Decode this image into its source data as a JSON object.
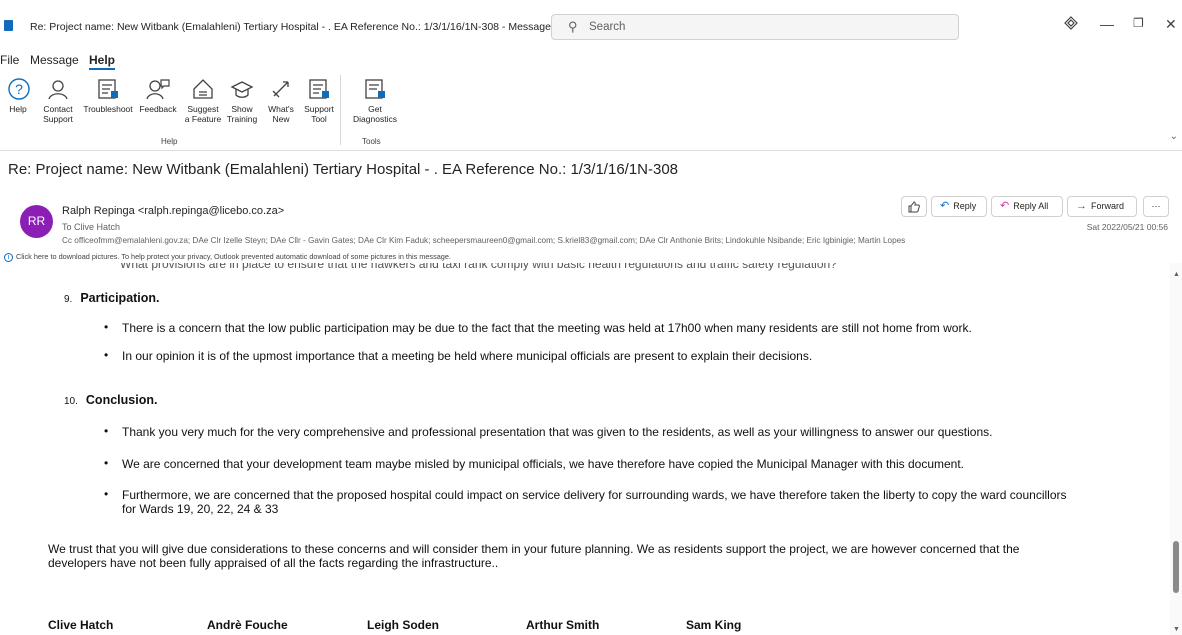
{
  "window": {
    "title": "Re: Project name: New Witbank (Emalahleni) Tertiary Hospital - . EA Reference No.: 1/3/1/16/1N-308  -  Message (HTML)",
    "search_placeholder": "Search"
  },
  "menu": {
    "file": "File",
    "message": "Message",
    "help": "Help"
  },
  "ribbon": {
    "help_group": {
      "label": "Help",
      "buttons": [
        {
          "line1": "Help",
          "line2": ""
        },
        {
          "line1": "Contact",
          "line2": "Support"
        },
        {
          "line1": "Troubleshoot",
          "line2": ""
        },
        {
          "line1": "Feedback",
          "line2": ""
        },
        {
          "line1": "Suggest",
          "line2": "a Feature"
        },
        {
          "line1": "Show",
          "line2": "Training"
        },
        {
          "line1": "What's",
          "line2": "New"
        },
        {
          "line1": "Support",
          "line2": "Tool"
        }
      ]
    },
    "tools_group": {
      "label": "Tools",
      "buttons": [
        {
          "line1": "Get",
          "line2": "Diagnostics"
        }
      ]
    }
  },
  "message": {
    "subject": "Re: Project name: New Witbank (Emalahleni) Tertiary Hospital - . EA Reference No.: 1/3/1/16/1N-308",
    "avatar_initials": "RR",
    "from": "Ralph Repinga <ralph.repinga@licebo.co.za>",
    "to": "To  Clive Hatch",
    "cc": "Cc  officeofmm@emalahleni.gov.za; DAe Clr Izelle Steyn; DAe Cllr - Gavin Gates; DAe Clr Kim Faduk; scheepersmaureen0@gmail.com; S.kriel83@gmail.com; DAe Clr Anthonie Brits; Lindokuhle Nsibande; Eric Igbinigie; Martin Lopes",
    "info_bar": "Click here to download pictures. To help protect your privacy, Outlook prevented automatic download of some pictures in this message.",
    "date": "Sat 2022/05/21 00:56",
    "actions": {
      "reply": "Reply",
      "reply_all": "Reply All",
      "forward": "Forward",
      "more": "···"
    }
  },
  "body": {
    "cut_line": "What provisions are in place to ensure that the hawkers and taxi rank comply with basic health regulations and traffic safety regulation?",
    "section9": {
      "number": "9.",
      "title": "Participation.",
      "bullets": [
        "There is a concern that the low public participation may be due to the fact that the meeting was held at 17h00 when many residents are still not home from work.",
        "In our opinion it is of the upmost importance that a meeting be held where municipal officials are present to explain their decisions."
      ]
    },
    "section10": {
      "number": "10.",
      "title": "Conclusion.",
      "bullets": [
        "Thank you very much for the very comprehensive and professional presentation that was given to the residents, as well as your willingness to answer our questions.",
        "We are concerned that your development team maybe misled by municipal officials, we have therefore have copied the Municipal Manager with this document.",
        "Furthermore, we are concerned that the proposed hospital could impact on service delivery for surrounding wards, we have therefore taken the liberty to copy the ward councillors",
        "for Wards 19, 20, 22, 24 & 33"
      ]
    },
    "closing": "We trust that you will give due considerations to these concerns and will consider them in your future planning. We as residents support the project, we are however concerned that the",
    "closing2": "developers have not been fully appraised of all the facts regarding the infrastructure..",
    "signatories": [
      "Clive Hatch",
      "Andrè Fouche",
      "Leigh Soden",
      "Arthur Smith",
      "Sam King"
    ]
  }
}
